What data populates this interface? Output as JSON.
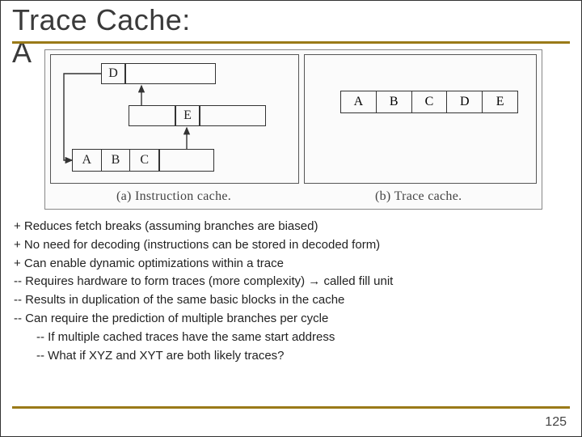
{
  "title_line1": "Trace Cache:",
  "title_line2_trunc": "A",
  "figure": {
    "left": {
      "D": "D",
      "E": "E",
      "ABC": [
        "A",
        "B",
        "C"
      ],
      "caption": "(a) Instruction cache."
    },
    "right": {
      "trace": [
        "A",
        "B",
        "C",
        "D",
        "E"
      ],
      "caption": "(b) Trace cache."
    }
  },
  "bullets": {
    "b1": "+ Reduces fetch breaks (assuming branches are biased)",
    "b2": "+ No need for decoding (instructions can be stored in decoded form)",
    "b3": "+ Can enable dynamic optimizations within a trace",
    "b4_pre": "-- Requires hardware to form traces (more complexity) ",
    "b4_arrow": "→",
    "b4_post": " called fill unit",
    "b5": "-- Results in duplication of the same basic blocks in the cache",
    "b6": "-- Can require the prediction of multiple branches per cycle",
    "b6a": "-- If multiple cached traces have the same start address",
    "b6b": "-- What if XYZ and XYT are both likely traces?"
  },
  "page_number": "125"
}
